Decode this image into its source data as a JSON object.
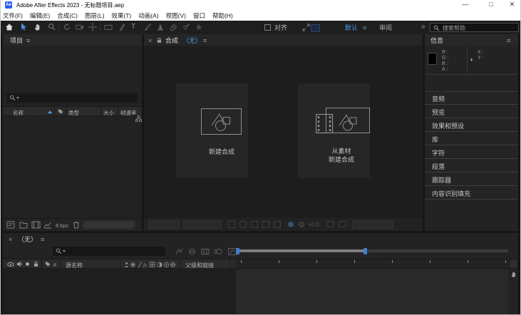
{
  "window": {
    "logo_text": "Ae",
    "title": "Adobe After Effects 2023 - 无标题项目.aep",
    "minimize_glyph": "—",
    "maximize_glyph": "□",
    "close_glyph": "✕"
  },
  "menu_bar": {
    "items": [
      "文件(F)",
      "编辑(E)",
      "合成(C)",
      "图层(L)",
      "效果(T)",
      "动画(A)",
      "视图(V)",
      "窗口",
      "帮助(H)"
    ]
  },
  "toolbar": {
    "snap_label": "对齐",
    "workspace_active": "默认",
    "workspace_menu_glyph": "≡",
    "workspace_secondary": "审阅",
    "overflow_glyph": "»",
    "search_placeholder": "搜索帮助"
  },
  "project_panel": {
    "tab_label": "项目",
    "panel_menu_glyph": "≡",
    "columns": {
      "name": "名称",
      "type": "类型",
      "size": "大小",
      "frame_rate": "帧速率"
    },
    "bit_depth_label": "8 bpc"
  },
  "comp_panel": {
    "close_glyph": "×",
    "tab_label": "合成",
    "tab_state": "（无）",
    "panel_menu_glyph": "≡",
    "new_comp_label": "新建合成",
    "from_footage_label_line1": "从素材",
    "from_footage_label_line2": "新建合成",
    "exposure_label": "+0.0"
  },
  "info_panel": {
    "tab_label": "信息",
    "panel_menu_glyph": "≡",
    "r_label": "R :",
    "g_label": "G :",
    "b_label": "B :",
    "a_label": "A :",
    "x_label": "X :",
    "y_label": "Y :"
  },
  "docked_panels": [
    "音频",
    "预览",
    "效果和预设",
    "库",
    "字符",
    "段落",
    "跟踪器",
    "内容识别填充"
  ],
  "timeline_panel": {
    "close_glyph": "×",
    "tab_state": "（无）",
    "panel_menu_glyph": "≡",
    "hash_label": "#",
    "source_name_column": "源名称",
    "parent_link_column": "父级和链接"
  },
  "colors": {
    "workspace_accent": "#4f9bea",
    "selection_blue": "#3f7fd2"
  }
}
